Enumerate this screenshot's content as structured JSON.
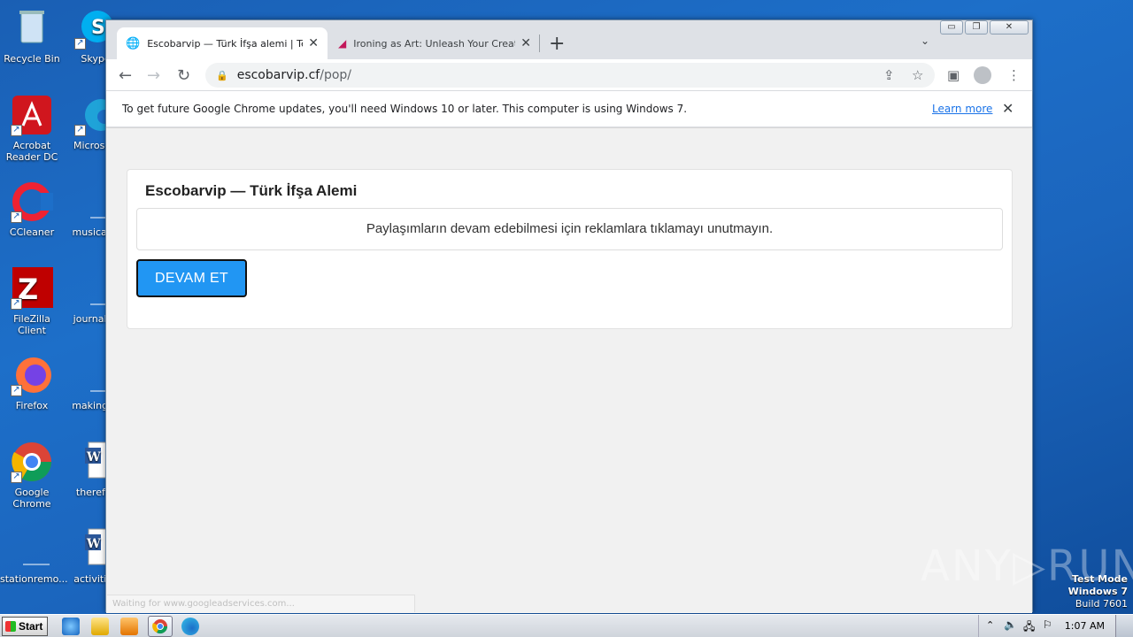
{
  "desktop": {
    "icons": [
      {
        "label": "Recycle Bin"
      },
      {
        "label": "Skype"
      },
      {
        "label": "Acrobat Reader DC"
      },
      {
        "label": "Microsoft"
      },
      {
        "label": "CCleaner"
      },
      {
        "label": "musicalfo"
      },
      {
        "label": "FileZilla Client"
      },
      {
        "label": "journalco"
      },
      {
        "label": "Firefox"
      },
      {
        "label": "makingac"
      },
      {
        "label": "Google Chrome"
      },
      {
        "label": "therefor"
      },
      {
        "label": "stationremo..."
      },
      {
        "label": "activities"
      }
    ]
  },
  "browser": {
    "tabs": [
      {
        "title": "Escobarvip — Türk İfşa alemi | Telegr",
        "active": true
      },
      {
        "title": "Ironing as Art: Unleash Your Creativ",
        "active": false
      }
    ],
    "new_tab": "+",
    "window_buttons": {
      "minimize": "▭",
      "restore": "❐",
      "close": "✕"
    },
    "address": {
      "host": "escobarvip.cf",
      "path": "/pop/"
    },
    "infobar": {
      "message": "To get future Google Chrome updates, you'll need Windows 10 or later. This computer is using Windows 7.",
      "link": "Learn more"
    },
    "status_text": "Waiting for www.googleadservices.com..."
  },
  "page": {
    "title": "Escobarvip — Türk İfşa Alemi",
    "notice": "Paylaşımların devam edebilmesi için reklamlara tıklamayı unutmayın.",
    "button": "DEVAM ET"
  },
  "watermark": {
    "brand": "ANY▷RUN"
  },
  "os": {
    "test_mode": "Test Mode",
    "version": "Windows 7",
    "build": "Build 7601",
    "start_label": "Start",
    "clock": "1:07 AM"
  }
}
